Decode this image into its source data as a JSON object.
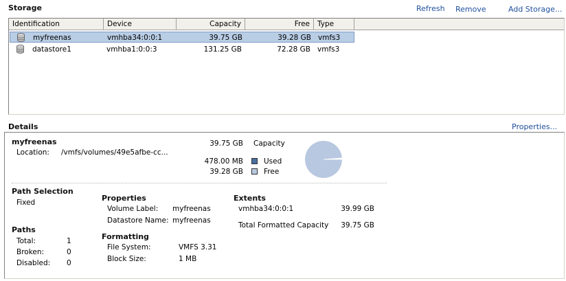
{
  "storage": {
    "title": "Storage",
    "actions": {
      "refresh": "Refresh",
      "remove": "Remove",
      "add": "Add Storage..."
    },
    "columns": [
      "Identification",
      "Device",
      "Capacity",
      "Free",
      "Type"
    ],
    "rows": [
      {
        "name": "myfreenas",
        "device": "vmhba34:0:0:1",
        "capacity": "39.75 GB",
        "free": "39.28 GB",
        "type": "vmfs3",
        "selected": true
      },
      {
        "name": "datastore1",
        "device": "vmhba1:0:0:3",
        "capacity": "131.25 GB",
        "free": "72.28 GB",
        "type": "vmfs3",
        "selected": false
      }
    ]
  },
  "details": {
    "title": "Details",
    "properties_link": "Properties...",
    "name": "myfreenas",
    "location_label": "Location:",
    "location_value": "/vmfs/volumes/49e5afbe-cc...",
    "capacity_value": "39.75 GB",
    "capacity_label": "Capacity",
    "used_value": "478.00 MB",
    "used_label": "Used",
    "free_value": "39.28 GB",
    "free_label": "Free",
    "used_fraction": 0.012,
    "colors": {
      "used": "#4a6f9f",
      "free": "#b8c8e0"
    },
    "path_selection": {
      "title": "Path Selection",
      "value": "Fixed"
    },
    "paths": {
      "title": "Paths",
      "total_label": "Total:",
      "total": "1",
      "broken_label": "Broken:",
      "broken": "0",
      "disabled_label": "Disabled:",
      "disabled": "0"
    },
    "properties": {
      "title": "Properties",
      "volume_label_label": "Volume Label:",
      "volume_label": "myfreenas",
      "datastore_name_label": "Datastore Name:",
      "datastore_name": "myfreenas"
    },
    "formatting": {
      "title": "Formatting",
      "file_system_label": "File System:",
      "file_system": "VMFS 3.31",
      "block_size_label": "Block Size:",
      "block_size": "1 MB"
    },
    "extents": {
      "title": "Extents",
      "device": "vmhba34:0:0:1",
      "device_size": "39.99 GB",
      "total_label": "Total Formatted Capacity",
      "total": "39.75 GB"
    }
  }
}
